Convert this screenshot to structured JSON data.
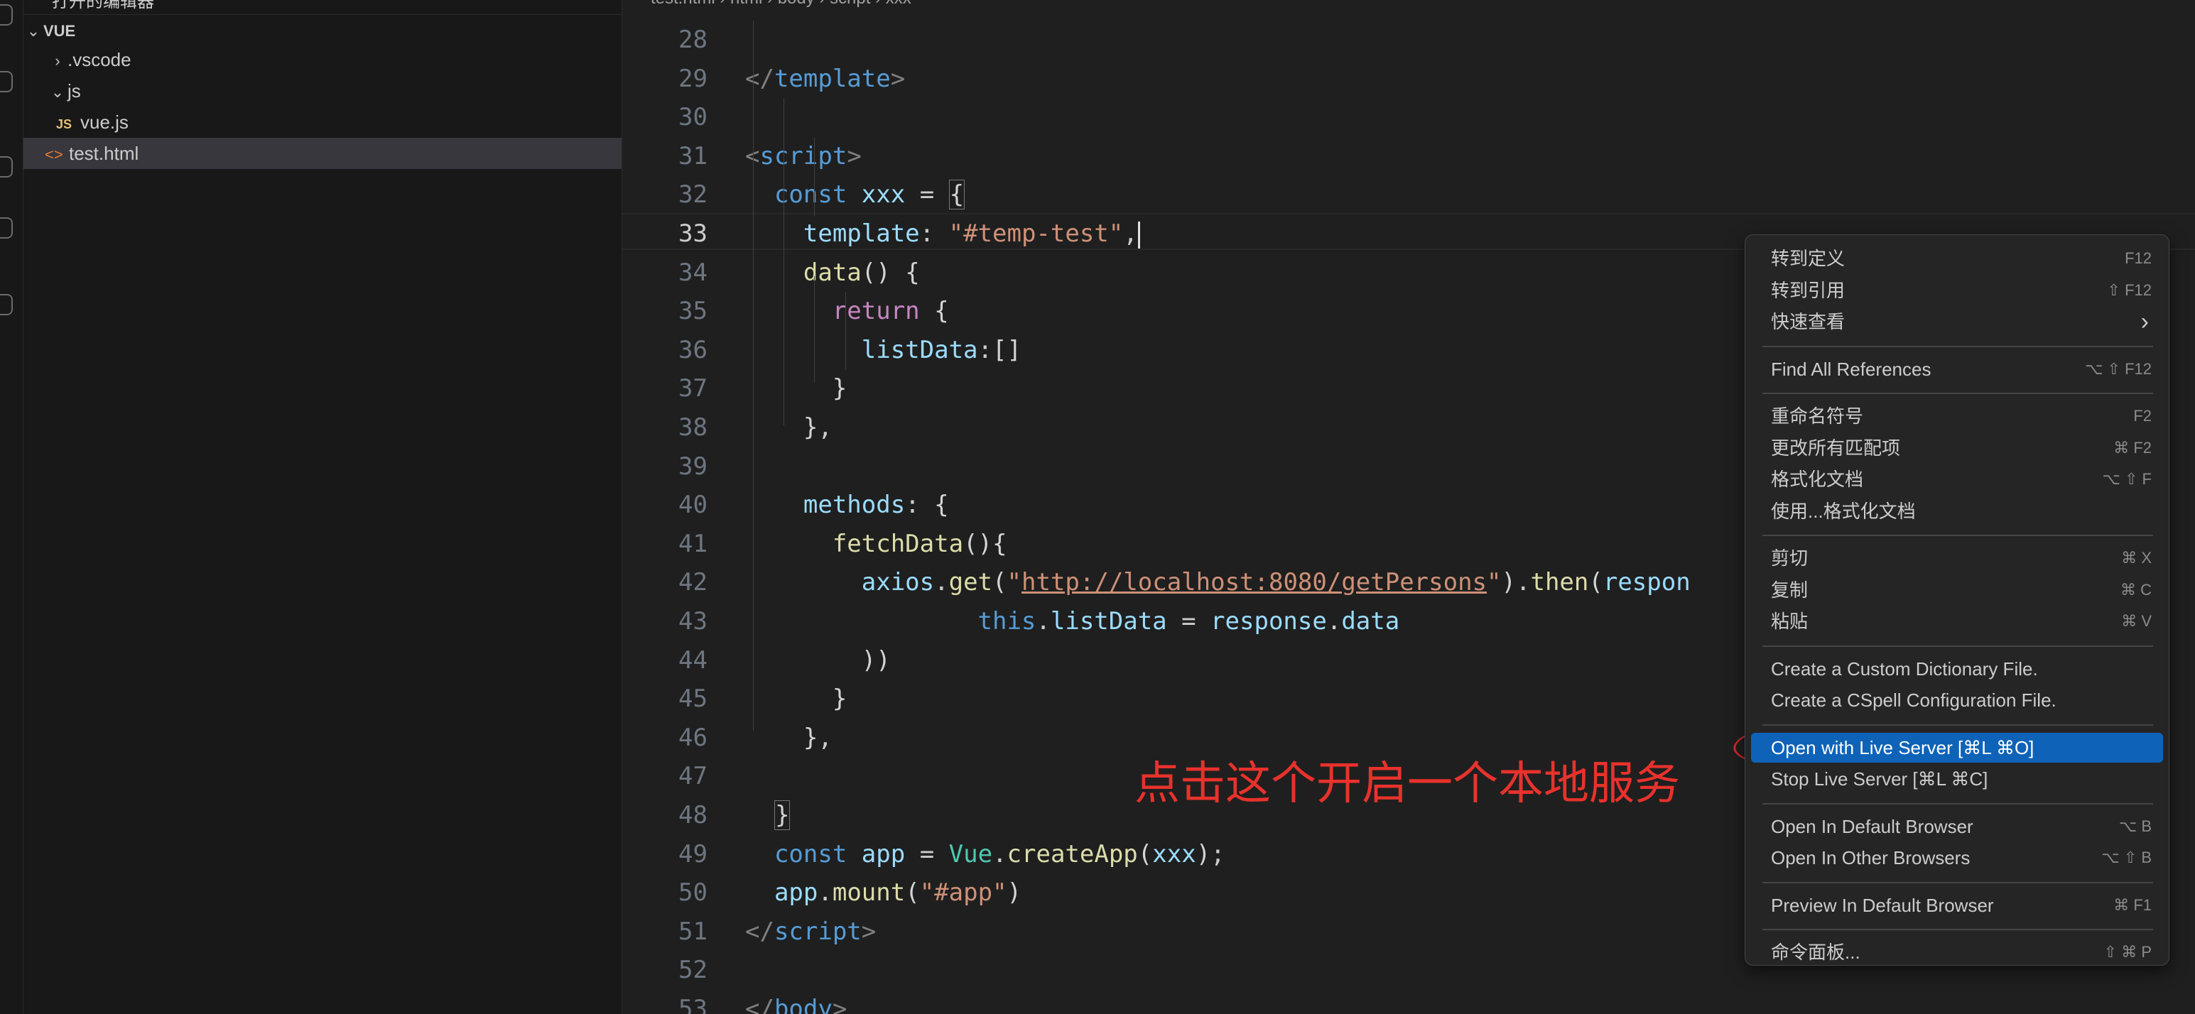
{
  "sidebar": {
    "top_label": "打开的编辑器",
    "section": "VUE",
    "items": [
      {
        "label": ".vscode",
        "kind": "folder-collapsed"
      },
      {
        "label": "js",
        "kind": "folder-expanded"
      },
      {
        "label": "vue.js",
        "kind": "js-file",
        "badge": "JS"
      },
      {
        "label": "test.html",
        "kind": "html-file",
        "badge": "<>"
      }
    ]
  },
  "breadcrumb": "test.html  ›  html  ›  body  ›  script  ›  xxx",
  "editor": {
    "active_line": "33",
    "lines": [
      {
        "n": "28"
      },
      {
        "n": "29"
      },
      {
        "n": "30"
      },
      {
        "n": "31"
      },
      {
        "n": "32"
      },
      {
        "n": "33"
      },
      {
        "n": "34"
      },
      {
        "n": "35"
      },
      {
        "n": "36"
      },
      {
        "n": "37"
      },
      {
        "n": "38"
      },
      {
        "n": "39"
      },
      {
        "n": "40"
      },
      {
        "n": "41"
      },
      {
        "n": "42"
      },
      {
        "n": "43"
      },
      {
        "n": "44"
      },
      {
        "n": "45"
      },
      {
        "n": "46"
      },
      {
        "n": "47"
      },
      {
        "n": "48"
      },
      {
        "n": "49"
      },
      {
        "n": "50"
      },
      {
        "n": "51"
      },
      {
        "n": "52"
      },
      {
        "n": "53"
      }
    ],
    "tokens": {
      "29": [
        [
          "k-pun",
          "</"
        ],
        [
          "k-tag",
          "template"
        ],
        [
          "k-pun",
          ">"
        ]
      ],
      "31": [
        [
          "k-pun",
          "<"
        ],
        [
          "k-tag",
          "script"
        ],
        [
          "k-pun",
          ">"
        ]
      ],
      "32": [
        [
          "",
          "  "
        ],
        [
          "k-kw",
          "const"
        ],
        [
          "",
          " "
        ],
        [
          "k-var",
          "xxx"
        ],
        [
          "",
          " = "
        ],
        [
          "k-br2",
          "{"
        ]
      ],
      "33": [
        [
          "",
          "    "
        ],
        [
          "k-var",
          "template"
        ],
        [
          "",
          ": "
        ],
        [
          "k-str",
          "\"#temp-test\""
        ],
        [
          "",
          ","
        ]
      ],
      "34": [
        [
          "",
          "    "
        ],
        [
          "k-fn",
          "data"
        ],
        [
          "k-br",
          "() {"
        ]
      ],
      "35": [
        [
          "",
          "      "
        ],
        [
          "k-ret",
          "return"
        ],
        [
          "",
          " "
        ],
        [
          "k-br",
          "{"
        ]
      ],
      "36": [
        [
          "",
          "        "
        ],
        [
          "k-var",
          "listData"
        ],
        [
          "",
          ":"
        ],
        [
          "k-br",
          "[]"
        ]
      ],
      "37": [
        [
          "",
          "      "
        ],
        [
          "k-br",
          "}"
        ]
      ],
      "38": [
        [
          "",
          "    "
        ],
        [
          "k-br",
          "}"
        ],
        [
          "",
          ","
        ]
      ],
      "40": [
        [
          "",
          "    "
        ],
        [
          "k-var",
          "methods"
        ],
        [
          "",
          ": "
        ],
        [
          "k-br",
          "{"
        ]
      ],
      "41": [
        [
          "",
          "      "
        ],
        [
          "k-fn",
          "fetchData"
        ],
        [
          "k-br",
          "(){"
        ]
      ],
      "42": [
        [
          "",
          "        "
        ],
        [
          "k-var",
          "axios"
        ],
        [
          "",
          "."
        ],
        [
          "k-fn",
          "get"
        ],
        [
          "k-br",
          "("
        ],
        [
          "k-str",
          "\""
        ],
        [
          "k-url",
          "http://localhost:8080/getPersons"
        ],
        [
          "k-str",
          "\""
        ],
        [
          "k-br",
          ")"
        ],
        [
          "",
          "."
        ],
        [
          "k-fn",
          "then"
        ],
        [
          "k-br",
          "("
        ],
        [
          "k-var",
          "respon"
        ]
      ],
      "43": [
        [
          "",
          "                "
        ],
        [
          "k-kw",
          "this"
        ],
        [
          "",
          "."
        ],
        [
          "k-var",
          "listData"
        ],
        [
          "",
          " = "
        ],
        [
          "k-var",
          "response"
        ],
        [
          "",
          "."
        ],
        [
          "k-var",
          "data"
        ]
      ],
      "44": [
        [
          "",
          "        "
        ],
        [
          "k-br",
          "))"
        ]
      ],
      "45": [
        [
          "",
          "      "
        ],
        [
          "k-br",
          "}"
        ]
      ],
      "46": [
        [
          "",
          "    "
        ],
        [
          "k-br",
          "}"
        ],
        [
          "",
          ","
        ]
      ],
      "48": [
        [
          "",
          "  "
        ],
        [
          "k-br2",
          "}"
        ]
      ],
      "49": [
        [
          "",
          "  "
        ],
        [
          "k-kw",
          "const"
        ],
        [
          "",
          " "
        ],
        [
          "k-var",
          "app"
        ],
        [
          "",
          " = "
        ],
        [
          "k-cls",
          "Vue"
        ],
        [
          "",
          "."
        ],
        [
          "k-fn",
          "createApp"
        ],
        [
          "k-br",
          "("
        ],
        [
          "k-var",
          "xxx"
        ],
        [
          "k-br",
          ")"
        ],
        [
          "",
          ";"
        ]
      ],
      "50": [
        [
          "",
          "  "
        ],
        [
          "k-var",
          "app"
        ],
        [
          "",
          "."
        ],
        [
          "k-fn",
          "mount"
        ],
        [
          "k-br",
          "("
        ],
        [
          "k-str",
          "\"#app\""
        ],
        [
          "k-br",
          ")"
        ]
      ],
      "51": [
        [
          "k-pun",
          "</"
        ],
        [
          "k-tag",
          "script"
        ],
        [
          "k-pun",
          ">"
        ]
      ],
      "53": [
        [
          "k-pun",
          "</"
        ],
        [
          "k-tag",
          "body"
        ],
        [
          "k-pun",
          ">"
        ]
      ]
    }
  },
  "annotation": "点击这个开启一个本地服务",
  "context_menu": {
    "items": [
      {
        "label": "转到定义",
        "shortcut": "F12"
      },
      {
        "label": "转到引用",
        "shortcut": "⇧ F12"
      },
      {
        "label": "快速查看",
        "shortcut": "",
        "submenu": "›"
      },
      {
        "sep": true
      },
      {
        "label": "Find All References",
        "shortcut": "⌥ ⇧ F12"
      },
      {
        "sep": true
      },
      {
        "label": "重命名符号",
        "shortcut": "F2"
      },
      {
        "label": "更改所有匹配项",
        "shortcut": "⌘ F2"
      },
      {
        "label": "格式化文档",
        "shortcut": "⌥ ⇧ F"
      },
      {
        "label": "使用...格式化文档",
        "shortcut": ""
      },
      {
        "sep": true
      },
      {
        "label": "剪切",
        "shortcut": "⌘ X"
      },
      {
        "label": "复制",
        "shortcut": "⌘ C"
      },
      {
        "label": "粘贴",
        "shortcut": "⌘ V"
      },
      {
        "sep": true
      },
      {
        "label": "Create a Custom Dictionary File.",
        "shortcut": ""
      },
      {
        "label": "Create a CSpell Configuration File.",
        "shortcut": ""
      },
      {
        "sep": true
      },
      {
        "label": "Open with Live Server [⌘L ⌘O]",
        "shortcut": "",
        "highlight": true
      },
      {
        "label": "Stop Live Server [⌘L ⌘C]",
        "shortcut": ""
      },
      {
        "sep": true
      },
      {
        "label": "Open In Default Browser",
        "shortcut": "⌥ B"
      },
      {
        "label": "Open In Other Browsers",
        "shortcut": "⌥ ⇧ B"
      },
      {
        "sep": true
      },
      {
        "label": "Preview In Default Browser",
        "shortcut": "⌘ F1"
      },
      {
        "sep": true
      },
      {
        "label": "命令面板...",
        "shortcut": "⇧ ⌘ P"
      }
    ]
  }
}
